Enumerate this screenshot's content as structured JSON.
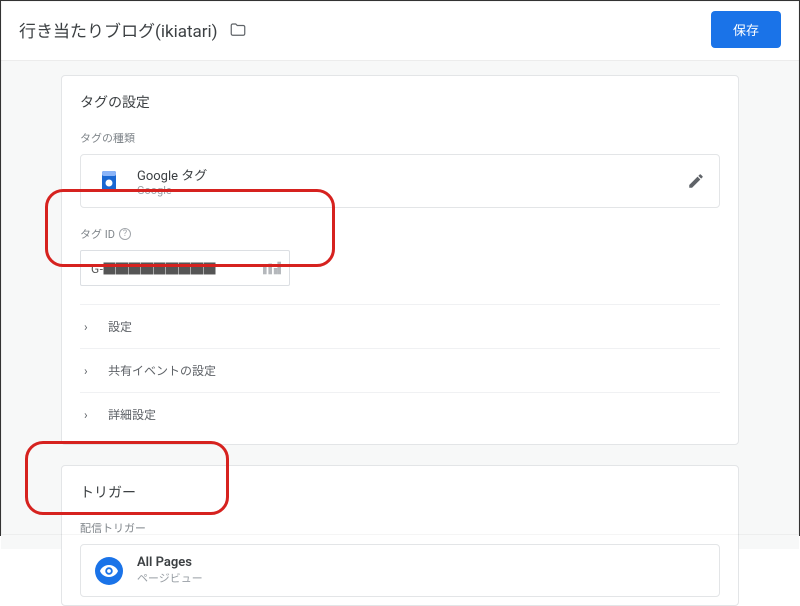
{
  "header": {
    "title": "行き当たりブログ(ikiatari)",
    "save_label": "保存"
  },
  "tag_settings": {
    "title": "タグの設定",
    "type_label": "タグの種類",
    "type": {
      "name": "Google タグ",
      "provider": "Google"
    },
    "tag_id_label": "タグ ID",
    "tag_id_value": "G-█████████",
    "collapsibles": [
      {
        "label": "設定"
      },
      {
        "label": "共有イベントの設定"
      },
      {
        "label": "詳細設定"
      }
    ]
  },
  "triggers": {
    "title": "トリガー",
    "section_label": "配信トリガー",
    "item": {
      "name": "All Pages",
      "subtitle": "ページビュー"
    }
  }
}
